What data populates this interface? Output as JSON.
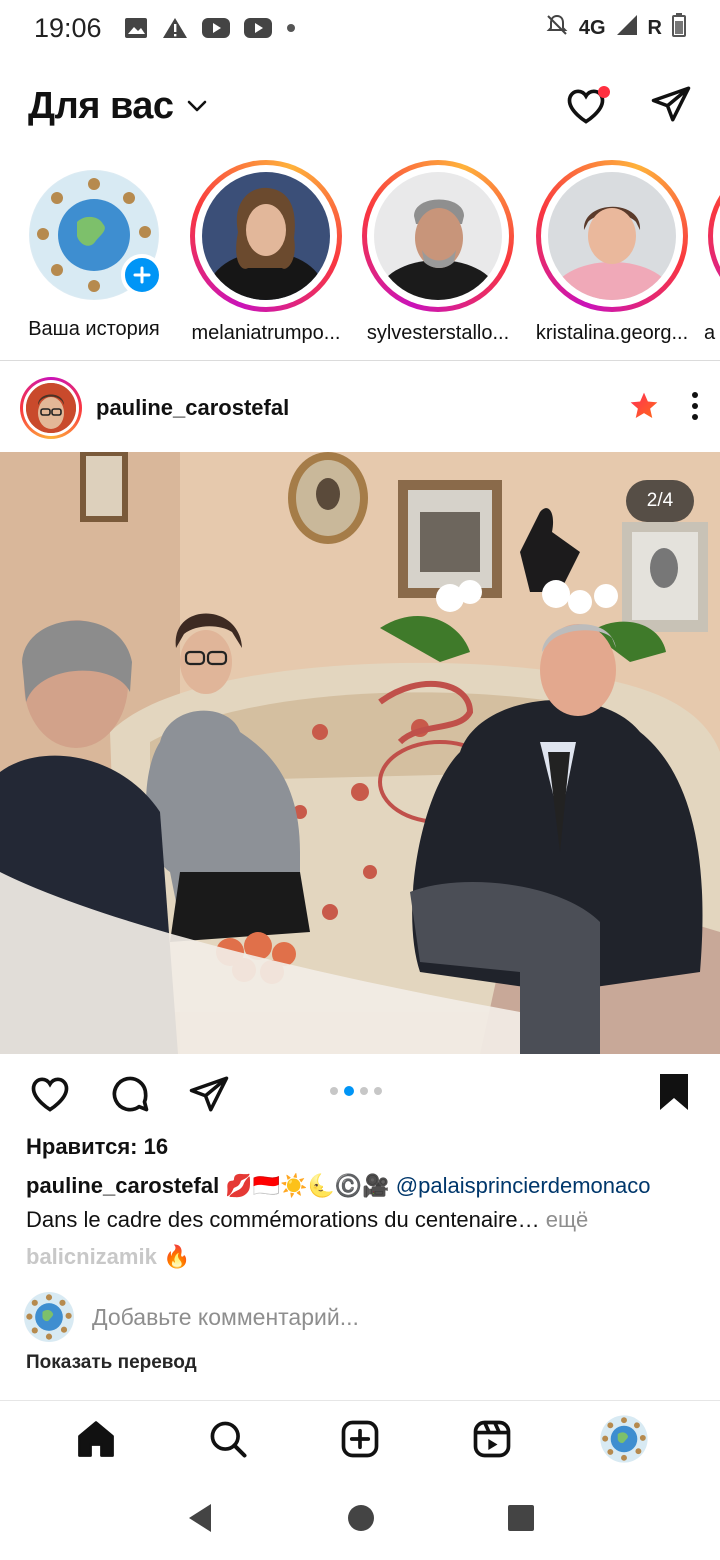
{
  "status_bar": {
    "time": "19:06",
    "network": "4G",
    "roaming": "R"
  },
  "header": {
    "title": "Для вас"
  },
  "stories": [
    {
      "label": "Ваша история",
      "own": true
    },
    {
      "label": "melaniatrumpo..."
    },
    {
      "label": "sylvesterstallo..."
    },
    {
      "label": "kristalina.georg..."
    },
    {
      "label": "a"
    }
  ],
  "post": {
    "username": "pauline_carostefal",
    "page_counter": "2/4",
    "carousel_total": 4,
    "carousel_index": 2,
    "likes": "Нравится: 16",
    "caption_user": "pauline_carostefal",
    "caption_emoji": "💋🇮🇩☀️🌜©️🎥",
    "caption_mention": "@palaisprincierdemonaco",
    "caption_text": "Dans le cadre des commémorations du centenaire…",
    "caption_more": " ещё",
    "comment_preview": "balicnizamik 🔥",
    "add_comment_placeholder": "Добавьте комментарий...",
    "translate": "Показать перевод"
  },
  "colors": {
    "accent": "#0095f6",
    "notification": "#ff3040",
    "favorite_star": "#ff3040"
  }
}
